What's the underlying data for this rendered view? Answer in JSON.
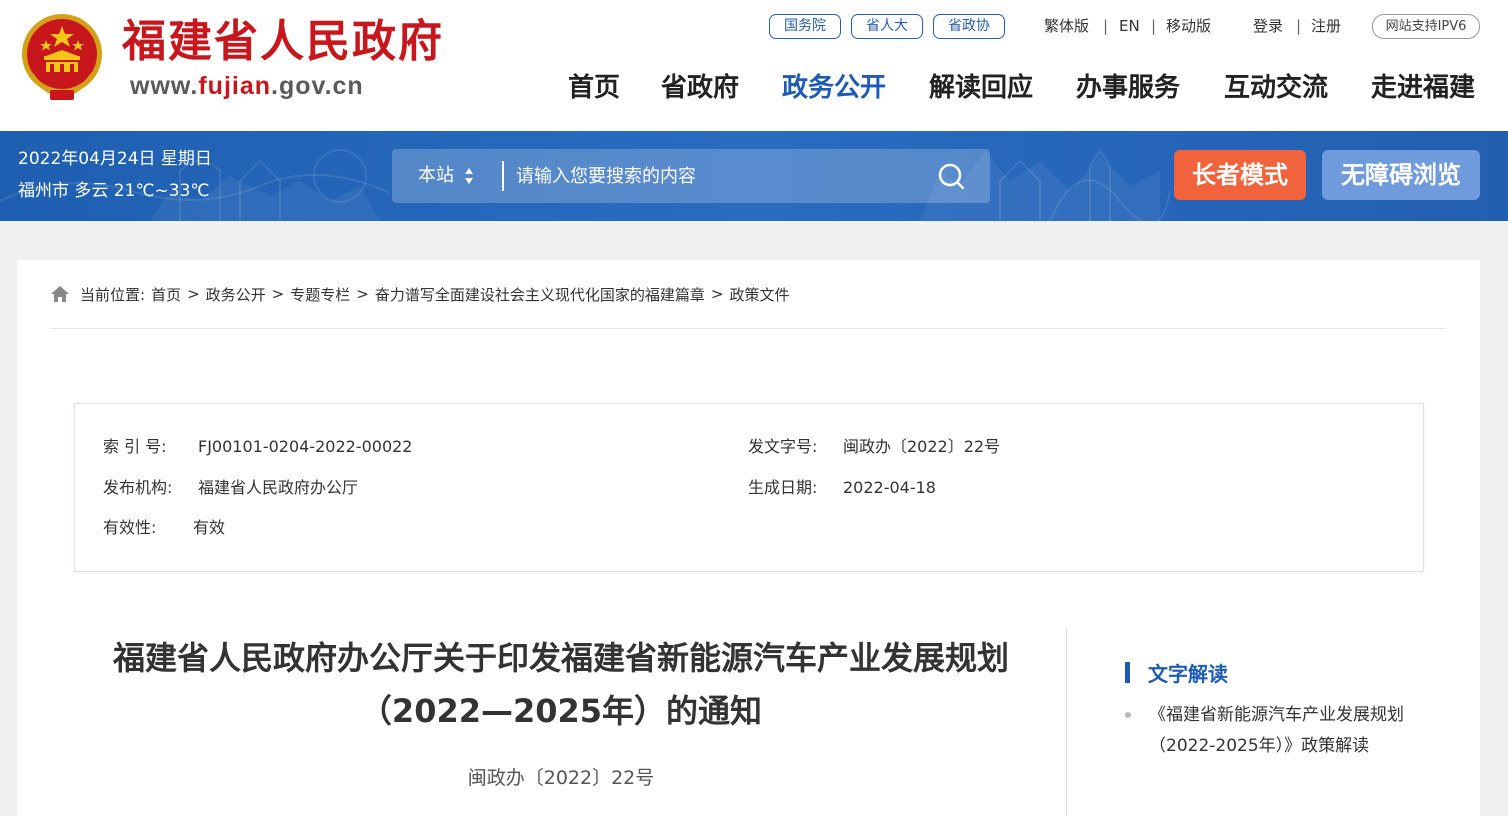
{
  "header": {
    "site_title": "福建省人民政府",
    "site_url_prefix": "www.",
    "site_url_highlight": "fujian",
    "site_url_suffix": ".gov.cn",
    "links": {
      "state_council": "国务院",
      "npc": "省人大",
      "cppcc": "省政协",
      "traditional": "繁体版",
      "english": "EN",
      "mobile": "移动版",
      "login": "登录",
      "register": "注册",
      "ipv6": "网站支持IPV6",
      "separator": "|"
    },
    "nav": [
      "首页",
      "省政府",
      "政务公开",
      "解读回应",
      "办事服务",
      "互动交流",
      "走进福建"
    ],
    "active_nav": "政务公开"
  },
  "band": {
    "date": "2022年04月24日 星期日",
    "weather": "福州市 多云 21℃~33℃",
    "search_scope": "本站",
    "search_placeholder": "请输入您要搜索的内容",
    "elder_mode": "长者模式",
    "accessibility": "无障碍浏览"
  },
  "breadcrumb": {
    "label": "当前位置:",
    "arrow": ">",
    "items": [
      "首页",
      "政务公开",
      "专题专栏",
      "奋力谱写全面建设社会主义现代化国家的福建篇章",
      "政策文件"
    ]
  },
  "meta": {
    "index_label": "索 引 号:",
    "index_value": "FJ00101-0204-2022-00022",
    "doc_no_label": "发文字号:",
    "doc_no_value": "闽政办〔2022〕22号",
    "publisher_label": "发布机构:",
    "publisher_value": "福建省人民政府办公厅",
    "date_label": "生成日期:",
    "date_value": "2022-04-18",
    "validity_label": "有效性:",
    "validity_value": "有效"
  },
  "article": {
    "title_line1": "福建省人民政府办公厅关于印发福建省新能源汽车产业发展规划",
    "title_line2": "（2022—2025年）的通知",
    "doc_number": "闽政办〔2022〕22号"
  },
  "sidebar": {
    "heading": "文字解读",
    "link": "《福建省新能源汽车产业发展规划（2022-2025年）》政策解读"
  },
  "colors": {
    "brand_red": "#c8161d",
    "brand_blue": "#1d5bb5",
    "elder_orange": "#f0633c",
    "access_blue": "#6f9adb"
  }
}
